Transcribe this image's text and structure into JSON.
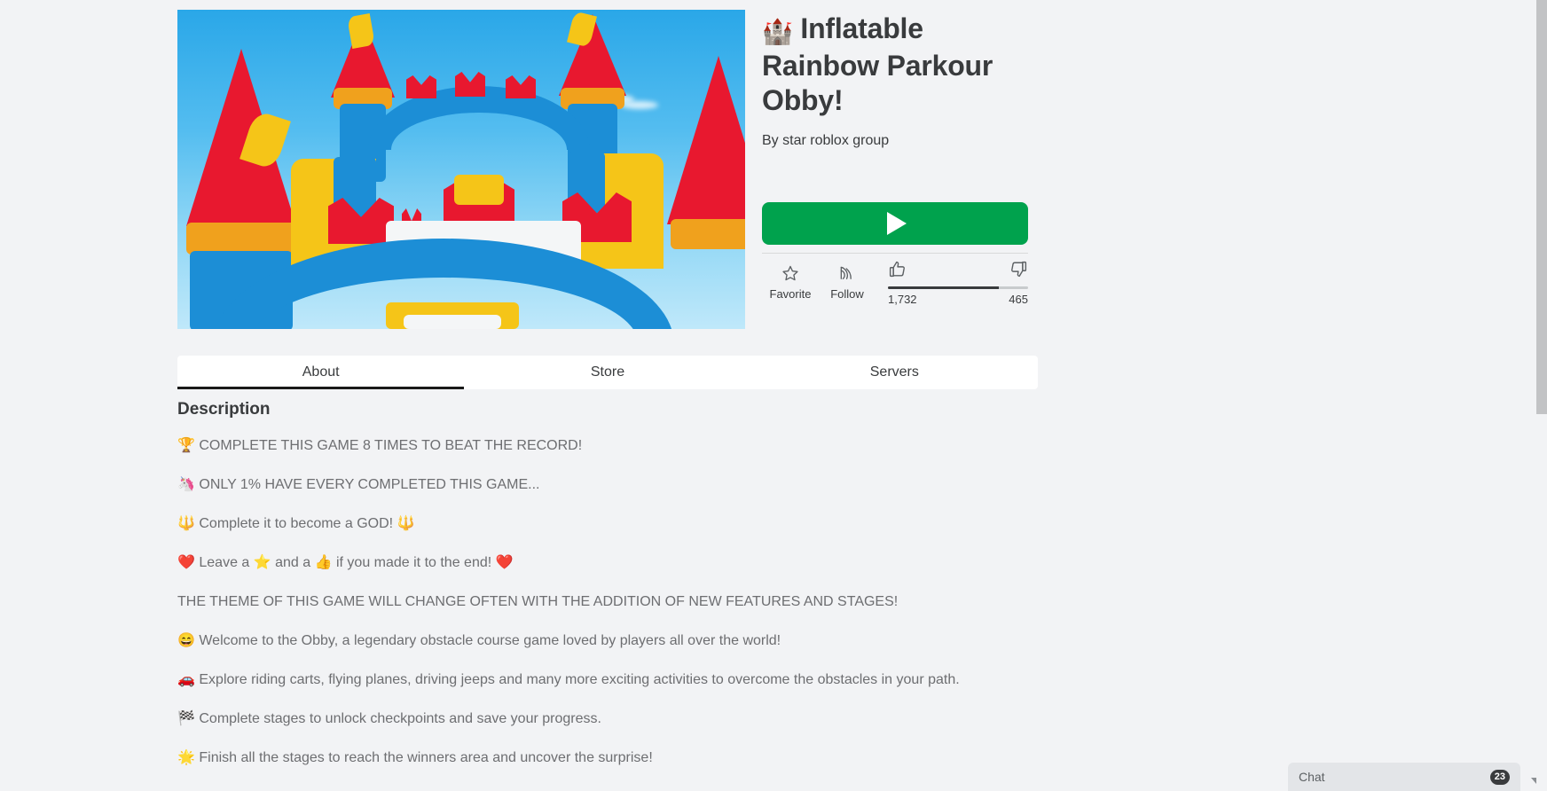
{
  "game": {
    "title_emoji": "🏰",
    "title": "Inflatable Rainbow Parkour Obby!",
    "by_prefix": "By",
    "creator": "star roblox group"
  },
  "actions": {
    "play_label": "",
    "play_icon": "play-triangle-icon",
    "favorite_label": "Favorite",
    "favorite_icon": "star-outline-icon",
    "follow_label": "Follow",
    "follow_icon": "rss-follow-icon",
    "like_icon": "thumbs-up-icon",
    "dislike_icon": "thumbs-down-icon",
    "like_count": "1,732",
    "dislike_count": "465",
    "like_ratio_percent": 79
  },
  "tabs": [
    {
      "label": "About",
      "active": true
    },
    {
      "label": "Store",
      "active": false
    },
    {
      "label": "Servers",
      "active": false
    }
  ],
  "description": {
    "heading": "Description",
    "lines": [
      "🏆 COMPLETE THIS GAME 8 TIMES TO BEAT THE RECORD!",
      "🦄 ONLY 1% HAVE EVERY COMPLETED THIS GAME...",
      "🔱 Complete it to become a GOD! 🔱",
      "❤️ Leave a ⭐ and a 👍 if you made it to the end! ❤️",
      "THE THEME OF THIS GAME WILL CHANGE OFTEN WITH THE ADDITION OF NEW FEATURES AND STAGES!",
      "😄 Welcome to the Obby, a legendary obstacle course game loved by players all over the world!",
      "🚗 Explore riding carts, flying planes, driving jeeps and many more exciting activities to overcome the obstacles in your path.",
      "🏁 Complete stages to unlock checkpoints and save your progress.",
      "🌟 Finish all the stages to reach the winners area and uncover the surprise!"
    ]
  },
  "chat": {
    "title": "Chat",
    "unread_badge": "23",
    "chevron_icon": "chevron-down-icon"
  },
  "colors": {
    "page_background": "#f2f3f5",
    "play_button": "#00a24d",
    "text_primary": "#393b3d",
    "text_secondary": "#6d6e71",
    "tab_active_underline": "#191919",
    "scrollbar_thumb": "#c2c3c5"
  }
}
